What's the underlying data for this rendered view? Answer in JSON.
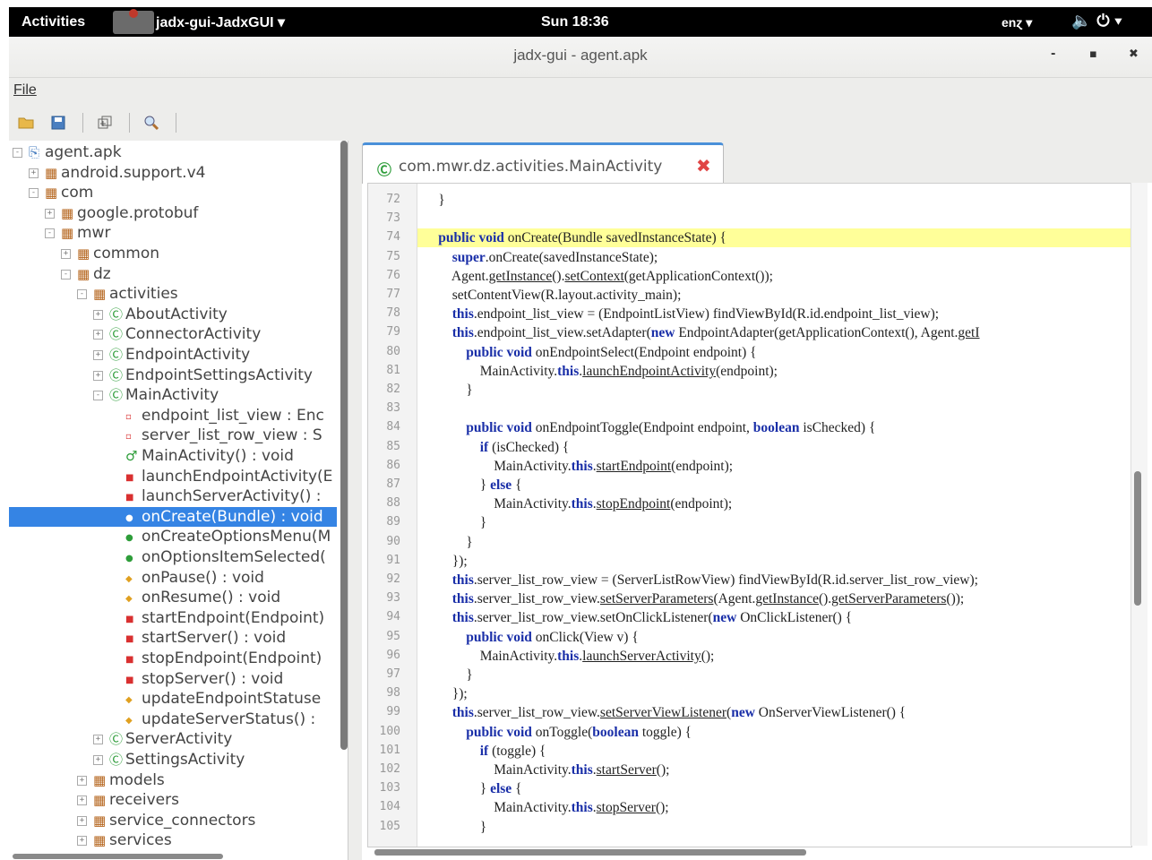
{
  "topbar": {
    "activities": "Activities",
    "app_name": "jadx-gui-JadxGUI ▾",
    "clock": "Sun 18:36",
    "language": "enɀ ▾",
    "tray_icons": [
      "volume-icon",
      "power-icon"
    ]
  },
  "window": {
    "title": "jadx-gui - agent.apk",
    "minimize": "‑",
    "maximize": "▪",
    "close": "✖"
  },
  "menu": {
    "file": "File"
  },
  "toolbar": {
    "icons": [
      "open-folder-icon",
      "save-icon",
      "sync-icon",
      "search-icon"
    ]
  },
  "tree": {
    "rows": [
      {
        "label": "agent.apk",
        "icon": "apk-icon",
        "depth": 0,
        "expander": "-"
      },
      {
        "label": "android.support.v4",
        "icon": "package-icon",
        "depth": 1,
        "expander": "+"
      },
      {
        "label": "com",
        "icon": "package-icon",
        "depth": 1,
        "expander": "-"
      },
      {
        "label": "google.protobuf",
        "icon": "package-icon",
        "depth": 2,
        "expander": "+"
      },
      {
        "label": "mwr",
        "icon": "package-icon",
        "depth": 2,
        "expander": "-"
      },
      {
        "label": "common",
        "icon": "package-icon",
        "depth": 3,
        "expander": "+"
      },
      {
        "label": "dz",
        "icon": "package-icon",
        "depth": 3,
        "expander": "-"
      },
      {
        "label": "activities",
        "icon": "package-icon",
        "depth": 4,
        "expander": "-"
      },
      {
        "label": "AboutActivity",
        "icon": "class-icon",
        "depth": 5,
        "expander": "+"
      },
      {
        "label": "ConnectorActivity",
        "icon": "class-icon",
        "depth": 5,
        "expander": "+"
      },
      {
        "label": "EndpointActivity",
        "icon": "class-icon",
        "depth": 5,
        "expander": "+"
      },
      {
        "label": "EndpointSettingsActivity",
        "icon": "class-icon",
        "depth": 5,
        "expander": "+"
      },
      {
        "label": "MainActivity",
        "icon": "class-icon",
        "depth": 5,
        "expander": "-"
      },
      {
        "label": "endpoint_list_view : Enc",
        "icon": "field-icon",
        "depth": 6,
        "expander": ""
      },
      {
        "label": "server_list_row_view : S",
        "icon": "field-icon",
        "depth": 6,
        "expander": ""
      },
      {
        "label": "MainActivity() : void",
        "icon": "constructor-icon",
        "depth": 6,
        "expander": ""
      },
      {
        "label": "launchEndpointActivity(E",
        "icon": "private-method-icon",
        "depth": 6,
        "expander": ""
      },
      {
        "label": "launchServerActivity() :",
        "icon": "private-method-icon",
        "depth": 6,
        "expander": ""
      },
      {
        "label": "onCreate(Bundle) : void",
        "icon": "public-method-icon",
        "depth": 6,
        "expander": "",
        "selected": true
      },
      {
        "label": "onCreateOptionsMenu(M",
        "icon": "public-method-icon",
        "depth": 6,
        "expander": ""
      },
      {
        "label": "onOptionsItemSelected(",
        "icon": "public-method-icon",
        "depth": 6,
        "expander": ""
      },
      {
        "label": "onPause() : void",
        "icon": "protected-method-icon",
        "depth": 6,
        "expander": ""
      },
      {
        "label": "onResume() : void",
        "icon": "protected-method-icon",
        "depth": 6,
        "expander": ""
      },
      {
        "label": "startEndpoint(Endpoint)",
        "icon": "private-method-icon",
        "depth": 6,
        "expander": ""
      },
      {
        "label": "startServer() : void",
        "icon": "private-method-icon",
        "depth": 6,
        "expander": ""
      },
      {
        "label": "stopEndpoint(Endpoint)",
        "icon": "private-method-icon",
        "depth": 6,
        "expander": ""
      },
      {
        "label": "stopServer() : void",
        "icon": "private-method-icon",
        "depth": 6,
        "expander": ""
      },
      {
        "label": "updateEndpointStatuse",
        "icon": "protected-method-icon",
        "depth": 6,
        "expander": ""
      },
      {
        "label": "updateServerStatus() :",
        "icon": "protected-method-icon",
        "depth": 6,
        "expander": ""
      },
      {
        "label": "ServerActivity",
        "icon": "class-icon",
        "depth": 5,
        "expander": "+"
      },
      {
        "label": "SettingsActivity",
        "icon": "class-icon",
        "depth": 5,
        "expander": "+"
      },
      {
        "label": "models",
        "icon": "package-icon",
        "depth": 4,
        "expander": "+"
      },
      {
        "label": "receivers",
        "icon": "package-icon",
        "depth": 4,
        "expander": "+"
      },
      {
        "label": "service_connectors",
        "icon": "package-icon",
        "depth": 4,
        "expander": "+"
      },
      {
        "label": "services",
        "icon": "package-icon",
        "depth": 4,
        "expander": "+"
      }
    ]
  },
  "tab": {
    "icon": "class-icon",
    "label": "com.mwr.dz.activities.MainActivity",
    "close": "✖"
  },
  "editor": {
    "highlight_line": "74",
    "lines": [
      {
        "n": "72",
        "indent": 1,
        "tokens": [
          [
            "p",
            "}"
          ]
        ]
      },
      {
        "n": "73",
        "indent": 0,
        "tokens": []
      },
      {
        "n": "74",
        "indent": 1,
        "tokens": [
          [
            "k",
            "public void "
          ],
          [
            "p",
            "onCreate(Bundle savedInstanceState) {"
          ]
        ]
      },
      {
        "n": "75",
        "indent": 2,
        "tokens": [
          [
            "k",
            "super"
          ],
          [
            "p",
            ".onCreate(savedInstanceState);"
          ]
        ]
      },
      {
        "n": "76",
        "indent": 2,
        "tokens": [
          [
            "p",
            "Agent."
          ],
          [
            "u",
            "getInstance"
          ],
          [
            "p",
            "()."
          ],
          [
            "u",
            "setContext"
          ],
          [
            "p",
            "(getApplicationContext());"
          ]
        ]
      },
      {
        "n": "77",
        "indent": 2,
        "tokens": [
          [
            "p",
            "setContentView(R.layout.activity_main);"
          ]
        ]
      },
      {
        "n": "78",
        "indent": 2,
        "tokens": [
          [
            "k",
            "this"
          ],
          [
            "p",
            ".endpoint_list_view = (EndpointListView) findViewById(R.id.endpoint_list_view);"
          ]
        ]
      },
      {
        "n": "79",
        "indent": 2,
        "tokens": [
          [
            "k",
            "this"
          ],
          [
            "p",
            ".endpoint_list_view.setAdapter("
          ],
          [
            "k",
            "new "
          ],
          [
            "p",
            "EndpointAdapter(getApplicationContext(), Agent."
          ],
          [
            "u",
            "getI"
          ]
        ]
      },
      {
        "n": "80",
        "indent": 3,
        "tokens": [
          [
            "k",
            "public void "
          ],
          [
            "p",
            "onEndpointSelect(Endpoint endpoint) {"
          ]
        ]
      },
      {
        "n": "81",
        "indent": 4,
        "tokens": [
          [
            "p",
            "MainActivity."
          ],
          [
            "k",
            "this"
          ],
          [
            "p",
            "."
          ],
          [
            "u",
            "launchEndpointActivity"
          ],
          [
            "p",
            "(endpoint);"
          ]
        ]
      },
      {
        "n": "82",
        "indent": 3,
        "tokens": [
          [
            "p",
            "}"
          ]
        ]
      },
      {
        "n": "83",
        "indent": 0,
        "tokens": []
      },
      {
        "n": "84",
        "indent": 3,
        "tokens": [
          [
            "k",
            "public void "
          ],
          [
            "p",
            "onEndpointToggle(Endpoint endpoint, "
          ],
          [
            "k",
            "boolean "
          ],
          [
            "p",
            "isChecked) {"
          ]
        ]
      },
      {
        "n": "85",
        "indent": 4,
        "tokens": [
          [
            "k",
            "if "
          ],
          [
            "p",
            "(isChecked) {"
          ]
        ]
      },
      {
        "n": "86",
        "indent": 5,
        "tokens": [
          [
            "p",
            "MainActivity."
          ],
          [
            "k",
            "this"
          ],
          [
            "p",
            "."
          ],
          [
            "u",
            "startEndpoint"
          ],
          [
            "p",
            "(endpoint);"
          ]
        ]
      },
      {
        "n": "87",
        "indent": 4,
        "tokens": [
          [
            "p",
            "} "
          ],
          [
            "k",
            "else "
          ],
          [
            "p",
            "{"
          ]
        ]
      },
      {
        "n": "88",
        "indent": 5,
        "tokens": [
          [
            "p",
            "MainActivity."
          ],
          [
            "k",
            "this"
          ],
          [
            "p",
            "."
          ],
          [
            "u",
            "stopEndpoint"
          ],
          [
            "p",
            "(endpoint);"
          ]
        ]
      },
      {
        "n": "89",
        "indent": 4,
        "tokens": [
          [
            "p",
            "}"
          ]
        ]
      },
      {
        "n": "90",
        "indent": 3,
        "tokens": [
          [
            "p",
            "}"
          ]
        ]
      },
      {
        "n": "91",
        "indent": 2,
        "tokens": [
          [
            "p",
            "});"
          ]
        ]
      },
      {
        "n": "92",
        "indent": 2,
        "tokens": [
          [
            "k",
            "this"
          ],
          [
            "p",
            ".server_list_row_view = (ServerListRowView) findViewById(R.id.server_list_row_view);"
          ]
        ]
      },
      {
        "n": "93",
        "indent": 2,
        "tokens": [
          [
            "k",
            "this"
          ],
          [
            "p",
            ".server_list_row_view."
          ],
          [
            "u",
            "setServerParameters"
          ],
          [
            "p",
            "(Agent."
          ],
          [
            "u",
            "getInstance"
          ],
          [
            "p",
            "()."
          ],
          [
            "u",
            "getServerParameters"
          ],
          [
            "p",
            "());"
          ]
        ]
      },
      {
        "n": "94",
        "indent": 2,
        "tokens": [
          [
            "k",
            "this"
          ],
          [
            "p",
            ".server_list_row_view.setOnClickListener("
          ],
          [
            "k",
            "new "
          ],
          [
            "p",
            "OnClickListener() {"
          ]
        ]
      },
      {
        "n": "95",
        "indent": 3,
        "tokens": [
          [
            "k",
            "public void "
          ],
          [
            "p",
            "onClick(View v) {"
          ]
        ]
      },
      {
        "n": "96",
        "indent": 4,
        "tokens": [
          [
            "p",
            "MainActivity."
          ],
          [
            "k",
            "this"
          ],
          [
            "p",
            "."
          ],
          [
            "u",
            "launchServerActivity"
          ],
          [
            "p",
            "();"
          ]
        ]
      },
      {
        "n": "97",
        "indent": 3,
        "tokens": [
          [
            "p",
            "}"
          ]
        ]
      },
      {
        "n": "98",
        "indent": 2,
        "tokens": [
          [
            "p",
            "});"
          ]
        ]
      },
      {
        "n": "99",
        "indent": 2,
        "tokens": [
          [
            "k",
            "this"
          ],
          [
            "p",
            ".server_list_row_view."
          ],
          [
            "u",
            "setServerViewListener"
          ],
          [
            "p",
            "("
          ],
          [
            "k",
            "new "
          ],
          [
            "p",
            "OnServerViewListener() {"
          ]
        ]
      },
      {
        "n": "100",
        "indent": 3,
        "tokens": [
          [
            "k",
            "public void "
          ],
          [
            "p",
            "onToggle("
          ],
          [
            "k",
            "boolean "
          ],
          [
            "p",
            "toggle) {"
          ]
        ]
      },
      {
        "n": "101",
        "indent": 4,
        "tokens": [
          [
            "k",
            "if "
          ],
          [
            "p",
            "(toggle) {"
          ]
        ]
      },
      {
        "n": "102",
        "indent": 5,
        "tokens": [
          [
            "p",
            "MainActivity."
          ],
          [
            "k",
            "this"
          ],
          [
            "p",
            "."
          ],
          [
            "u",
            "startServer"
          ],
          [
            "p",
            "();"
          ]
        ]
      },
      {
        "n": "103",
        "indent": 4,
        "tokens": [
          [
            "p",
            "} "
          ],
          [
            "k",
            "else "
          ],
          [
            "p",
            "{"
          ]
        ]
      },
      {
        "n": "104",
        "indent": 5,
        "tokens": [
          [
            "p",
            "MainActivity."
          ],
          [
            "k",
            "this"
          ],
          [
            "p",
            "."
          ],
          [
            "u",
            "stopServer"
          ],
          [
            "p",
            "();"
          ]
        ]
      },
      {
        "n": "105",
        "indent": 4,
        "tokens": [
          [
            "p",
            "}"
          ]
        ]
      }
    ]
  },
  "colors": {
    "selection": "#3584e4",
    "keyword": "#1a2fa8",
    "highlight": "#ffff99",
    "package_icon": "#b5651d",
    "class_icon": "#2e9d3a",
    "private_method": "#d93030",
    "public_method": "#2e9d3a",
    "protected_method": "#e0a020"
  }
}
